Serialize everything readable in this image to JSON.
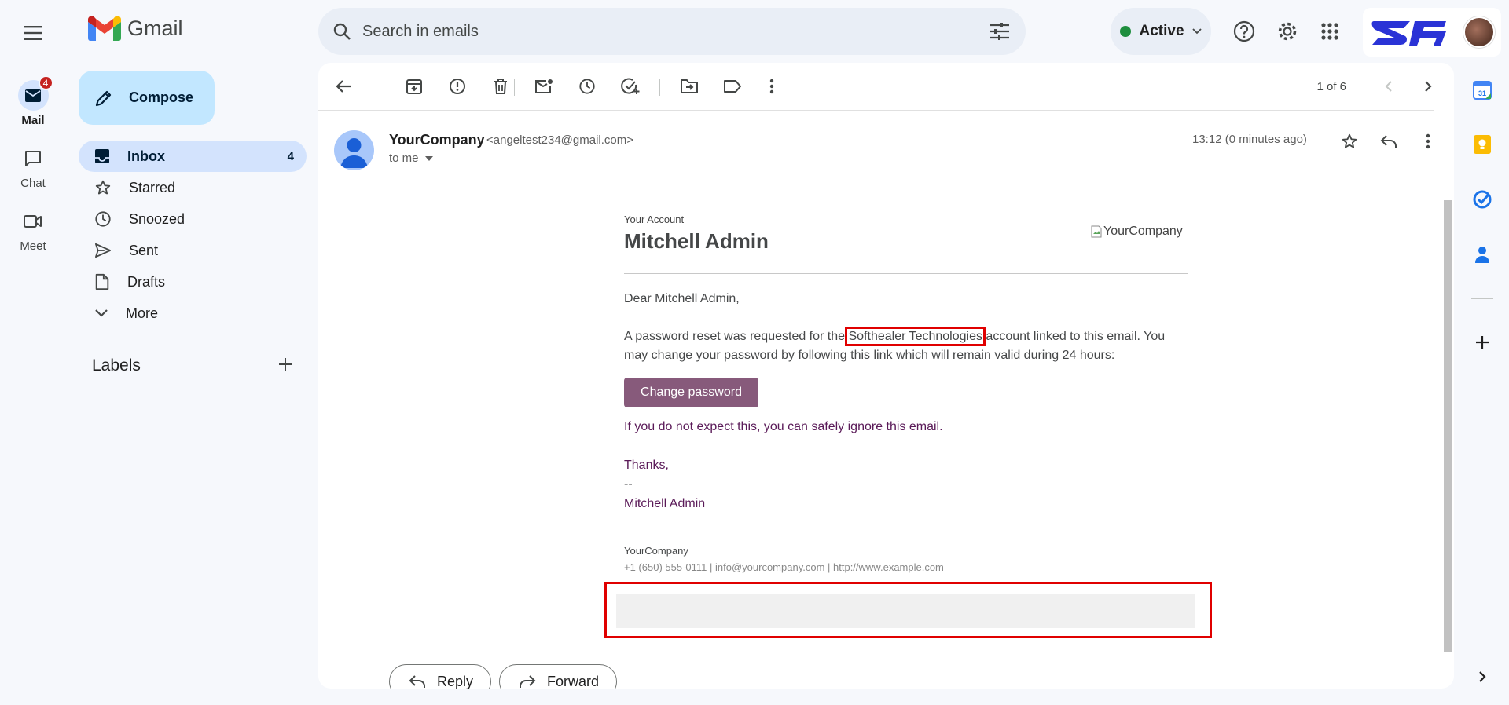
{
  "app": {
    "name": "Gmail"
  },
  "rail": {
    "mail": {
      "label": "Mail",
      "badge": "4"
    },
    "chat": {
      "label": "Chat"
    },
    "meet": {
      "label": "Meet"
    }
  },
  "search": {
    "placeholder": "Search in emails"
  },
  "status": {
    "label": "Active",
    "color": "#1e8e3e"
  },
  "compose": {
    "label": "Compose"
  },
  "nav": {
    "items": [
      {
        "label": "Inbox",
        "count": "4",
        "icon": "inbox-icon"
      },
      {
        "label": "Starred",
        "icon": "star-icon"
      },
      {
        "label": "Snoozed",
        "icon": "clock-icon"
      },
      {
        "label": "Sent",
        "icon": "send-icon"
      },
      {
        "label": "Drafts",
        "icon": "draft-icon"
      },
      {
        "label": "More",
        "icon": "chevron-down-icon"
      }
    ],
    "labels_heading": "Labels"
  },
  "toolbar": {
    "pager": "1 of 6"
  },
  "message": {
    "sender_name": "YourCompany",
    "sender_email": "<angeltest234@gmail.com>",
    "to": "to me",
    "time": "13:12 (0 minutes ago)"
  },
  "email": {
    "account_caption": "Your Account",
    "account_name": "Mitchell Admin",
    "logo_alt": "YourCompany",
    "greeting": "Dear Mitchell Admin,",
    "reset_before": "A password reset was requested for the ",
    "company_highlight": "Softhealer Technologies",
    "reset_after": " account linked to this email. You may change your password by following this link which will remain valid during 24 hours:",
    "button": "Change password",
    "ignore": "If you do not expect this, you can safely ignore this email.",
    "thanks": "Thanks,",
    "dashes": "--",
    "signature": "Mitchell Admin",
    "footer_company": "YourCompany",
    "footer_contact": "+1 (650) 555-0111 | info@yourcompany.com | http://www.example.com",
    "button_color": "#875a7b",
    "highlight_color": "#e00000"
  },
  "actions": {
    "reply": "Reply",
    "forward": "Forward"
  }
}
